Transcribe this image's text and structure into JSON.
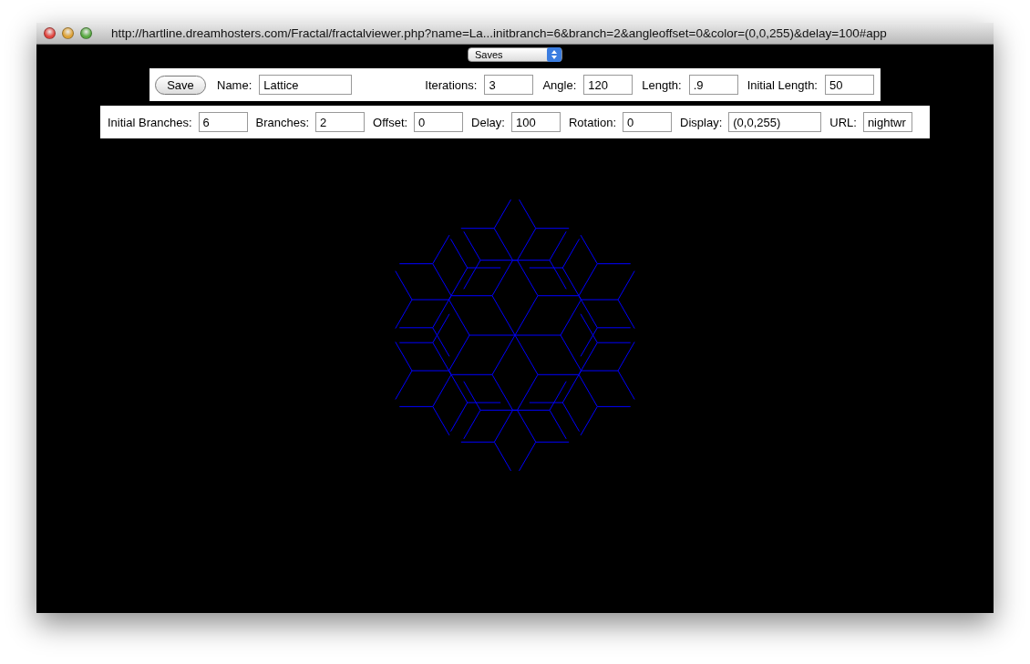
{
  "window": {
    "title": "http://hartline.dreamhosters.com/Fractal/fractalviewer.php?name=La...initbranch=6&branch=2&angleoffset=0&color=(0,0,255)&delay=100#app"
  },
  "saves_select": {
    "value": "Saves"
  },
  "save_button": {
    "label": "Save"
  },
  "row_1": [
    {
      "label": "Name:",
      "value": "Lattice"
    },
    {
      "label": "Iterations:",
      "value": "3"
    },
    {
      "label": "Angle:",
      "value": "120"
    },
    {
      "label": "Length:",
      "value": ".9"
    },
    {
      "label": "Initial Length:",
      "value": "50"
    }
  ],
  "row_2": [
    {
      "label": "Initial Branches:",
      "value": "6"
    },
    {
      "label": "Branches:",
      "value": "2"
    },
    {
      "label": "Offset:",
      "value": "0"
    },
    {
      "label": "Delay:",
      "value": "100"
    },
    {
      "label": "Rotation:",
      "value": "0"
    },
    {
      "label": "Display:",
      "value": "(0,0,255)"
    },
    {
      "label": "URL:",
      "value": "nightwr"
    }
  ]
}
